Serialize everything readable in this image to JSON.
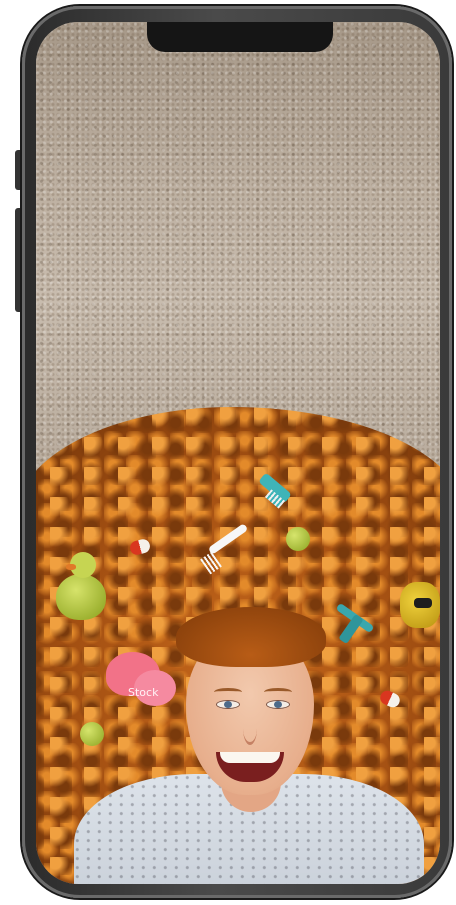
{
  "device": {
    "type": "smartphone",
    "frame_color": "#3a3a3a",
    "screen": {
      "scene": "photo",
      "sticker_text": "Stock"
    }
  }
}
